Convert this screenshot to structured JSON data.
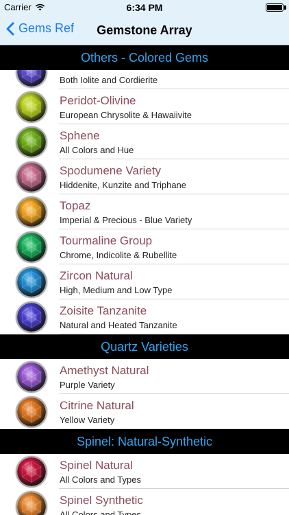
{
  "status_bar": {
    "carrier": "Carrier",
    "time": "6:34 PM"
  },
  "nav": {
    "back_label": "Gems Ref",
    "title": "Gemstone Array"
  },
  "sections": [
    {
      "header": "Others - Colored Gems",
      "rows": [
        {
          "title": "",
          "subtitle": "Both Iolite and Cordierite",
          "color": "#5b4bd0"
        },
        {
          "title": "Peridot-Olivine",
          "subtitle": "European Chrysolite & Hawaiivite",
          "color": "#b9d21a"
        },
        {
          "title": "Sphene",
          "subtitle": "All Colors and Hue",
          "color": "#6cae16"
        },
        {
          "title": "Spodumene Variety",
          "subtitle": "Hiddenite, Kunzite and Triphane",
          "color": "#c56a8c"
        },
        {
          "title": "Topaz",
          "subtitle": "Imperial & Precious - Blue Variety",
          "color": "#f0a21e"
        },
        {
          "title": "Tourmaline Group",
          "subtitle": "Chrome, Indicolite & Rubellite",
          "color": "#16b25a"
        },
        {
          "title": "Zircon Natural",
          "subtitle": "High, Medium and Low Type",
          "color": "#1f8fd6"
        },
        {
          "title": "Zoisite Tanzanite",
          "subtitle": "Natural and Heated Tanzanite",
          "color": "#4a3fd2"
        }
      ]
    },
    {
      "header": "Quartz Varieties",
      "rows": [
        {
          "title": "Amethyst Natural",
          "subtitle": "Purple Variety",
          "color": "#9b59d8"
        },
        {
          "title": "Citrine Natural",
          "subtitle": "Yellow Variety",
          "color": "#e0761c"
        }
      ]
    },
    {
      "header": "Spinel: Natural-Synthetic",
      "rows": [
        {
          "title": "Spinel Natural",
          "subtitle": "All Colors and Types",
          "color": "#c8143c"
        },
        {
          "title": "Spinel Synthetic",
          "subtitle": "All Colors and Types",
          "color": "#e8862a"
        }
      ]
    }
  ]
}
